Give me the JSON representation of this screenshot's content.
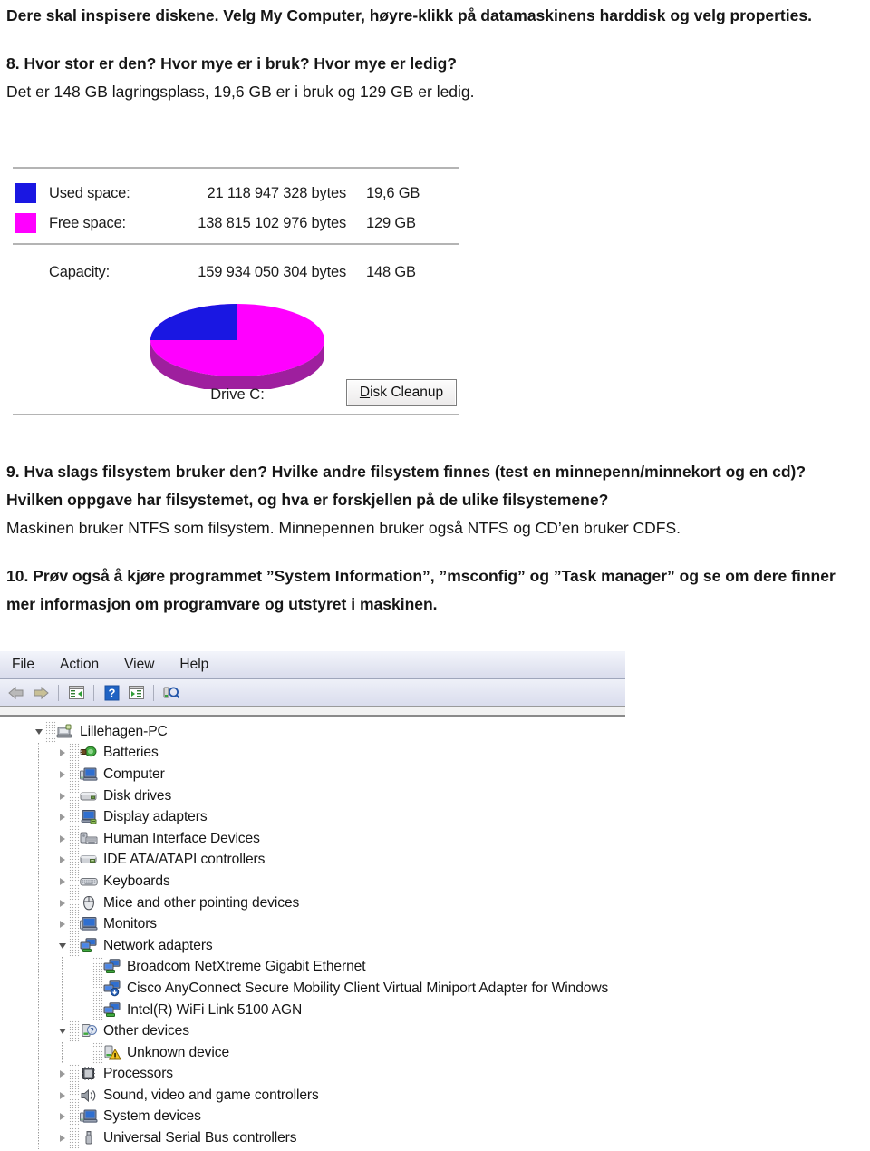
{
  "document": {
    "paragraphs": [
      {
        "id": "p-intro",
        "style": "bold",
        "text": "Dere skal inspisere diskene. Velg My Computer, høyre-klikk på datamaskinens harddisk og velg properties."
      },
      {
        "id": "q8",
        "style": "bold",
        "text": "8. Hvor stor er den? Hvor mye er i bruk? Hvor mye er ledig?"
      },
      {
        "id": "a8",
        "style": "answer",
        "text": "Det er 148 GB lagringsplass, 19,6 GB er i bruk og 129 GB er ledig."
      },
      {
        "id": "q9",
        "style": "bold",
        "text": "9. Hva slags filsystem bruker den? Hvilke andre filsystem finnes (test en minnepenn/minnekort og en cd)? Hvilken oppgave har filsystemet, og hva er forskjellen på de ulike filsystemene?"
      },
      {
        "id": "a9",
        "style": "answer",
        "text": "Maskinen bruker NTFS som filsystem. Minnepennen bruker også NTFS og CD’en bruker CDFS."
      },
      {
        "id": "q10",
        "style": "bold",
        "text": "10. Prøv også å kjøre programmet ”System Information”, ”msconfig” og ”Task manager” og se om dere finner mer informasjon om programvare og utstyret i maskinen."
      }
    ]
  },
  "disk_properties": {
    "rows": [
      {
        "swatch": "used",
        "label": "Used space:",
        "bytes": "21 118 947 328 bytes",
        "size": "19,6 GB"
      },
      {
        "swatch": "free",
        "label": "Free space:",
        "bytes": "138 815 102 976 bytes",
        "size": "129 GB"
      },
      {
        "swatch": "blank",
        "label": "Capacity:",
        "bytes": "159 934 050 304 bytes",
        "size": "148 GB"
      }
    ],
    "drive_caption": "Drive C:",
    "cleanup_button": {
      "accel": "D",
      "rest": "isk Cleanup",
      "full_label": "Disk Cleanup"
    },
    "colors": {
      "used": "#1a17e2",
      "free": "#ff00ff",
      "free_side": "#9e1f9e",
      "used_side": "#15119b",
      "rule": "#b4b4b4"
    },
    "chart_data": {
      "type": "pie",
      "title": "Drive C:",
      "labels": [
        "Used space",
        "Free space"
      ],
      "values": [
        19.6,
        129
      ],
      "units": "GB",
      "percentages": [
        13.2,
        86.8
      ],
      "colors": [
        "#1a17e2",
        "#ff00ff"
      ],
      "legend_position": "top",
      "three_d": true
    }
  },
  "device_manager": {
    "menu": [
      {
        "label": "File"
      },
      {
        "label": "Action"
      },
      {
        "label": "View"
      },
      {
        "label": "Help"
      }
    ],
    "toolbar": [
      {
        "icon": "back-arrow-icon"
      },
      {
        "icon": "forward-arrow-icon"
      },
      {
        "icon": "show-console-tree-icon"
      },
      {
        "icon": "help-icon"
      },
      {
        "icon": "properties-icon"
      },
      {
        "icon": "scan-hardware-changes-icon"
      }
    ],
    "tree": [
      {
        "label": "Lillehagen-PC",
        "depth": 0,
        "state": "expanded",
        "icon": "computer-root-icon"
      },
      {
        "label": "Batteries",
        "depth": 1,
        "state": "collapsed",
        "icon": "battery-icon"
      },
      {
        "label": "Computer",
        "depth": 1,
        "state": "collapsed",
        "icon": "computer-icon"
      },
      {
        "label": "Disk drives",
        "depth": 1,
        "state": "collapsed",
        "icon": "disk-drive-icon"
      },
      {
        "label": "Display adapters",
        "depth": 1,
        "state": "collapsed",
        "icon": "display-adapter-icon"
      },
      {
        "label": "Human Interface Devices",
        "depth": 1,
        "state": "collapsed",
        "icon": "hid-icon"
      },
      {
        "label": "IDE ATA/ATAPI controllers",
        "depth": 1,
        "state": "collapsed",
        "icon": "ide-controller-icon"
      },
      {
        "label": "Keyboards",
        "depth": 1,
        "state": "collapsed",
        "icon": "keyboard-icon"
      },
      {
        "label": "Mice and other pointing devices",
        "depth": 1,
        "state": "collapsed",
        "icon": "mouse-icon"
      },
      {
        "label": "Monitors",
        "depth": 1,
        "state": "collapsed",
        "icon": "monitor-icon"
      },
      {
        "label": "Network adapters",
        "depth": 1,
        "state": "expanded",
        "icon": "network-adapter-icon"
      },
      {
        "label": "Broadcom NetXtreme Gigabit Ethernet",
        "depth": 2,
        "state": "leaf",
        "icon": "network-adapter-icon"
      },
      {
        "label": "Cisco AnyConnect Secure Mobility Client Virtual Miniport Adapter for Windows",
        "depth": 2,
        "state": "leaf",
        "icon": "network-adapter-virtual-icon"
      },
      {
        "label": "Intel(R) WiFi Link 5100 AGN",
        "depth": 2,
        "state": "leaf",
        "icon": "network-adapter-icon"
      },
      {
        "label": "Other devices",
        "depth": 1,
        "state": "expanded",
        "icon": "unknown-device-icon"
      },
      {
        "label": "Unknown device",
        "depth": 2,
        "state": "leaf",
        "icon": "unknown-device-warning-icon"
      },
      {
        "label": "Processors",
        "depth": 1,
        "state": "collapsed",
        "icon": "processor-icon"
      },
      {
        "label": "Sound, video and game controllers",
        "depth": 1,
        "state": "collapsed",
        "icon": "sound-icon"
      },
      {
        "label": "System devices",
        "depth": 1,
        "state": "collapsed",
        "icon": "system-device-icon"
      },
      {
        "label": "Universal Serial Bus controllers",
        "depth": 1,
        "state": "collapsed",
        "icon": "usb-icon"
      }
    ]
  }
}
